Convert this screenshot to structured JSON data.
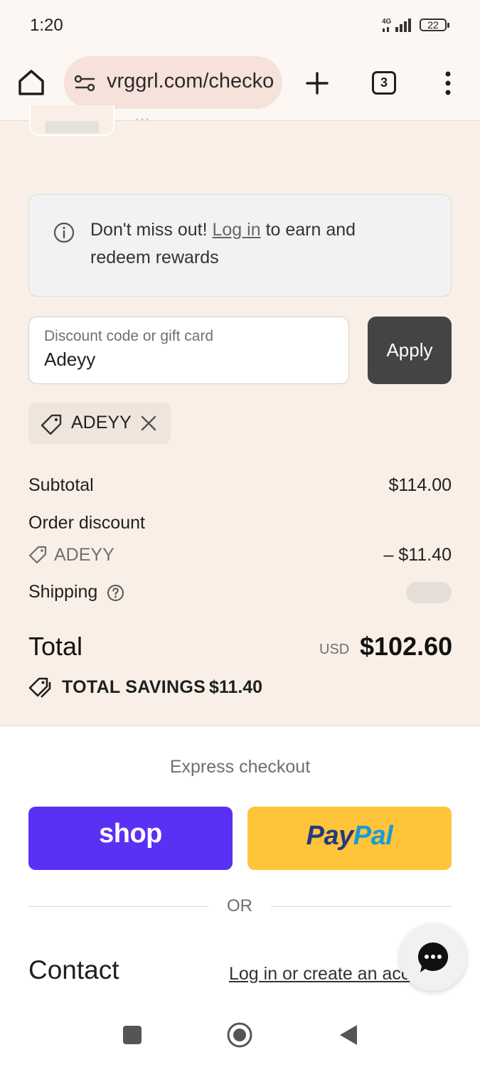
{
  "status_bar": {
    "time": "1:20",
    "network": "4G",
    "battery": "22"
  },
  "browser": {
    "url": "vrggrl.com/checkout",
    "tab_count": "3"
  },
  "rewards": {
    "prefix": "Don't miss out! ",
    "link": "Log in",
    "suffix": " to earn and redeem rewards"
  },
  "discount": {
    "placeholder": "Discount code or gift card",
    "value": "Adeyy",
    "apply_label": "Apply",
    "applied_code": "ADEYY"
  },
  "summary": {
    "subtotal_label": "Subtotal",
    "subtotal_value": "$114.00",
    "order_discount_label": "Order discount",
    "discount_code": "ADEYY",
    "discount_amount": "– $11.40",
    "shipping_label": "Shipping",
    "total_label": "Total",
    "currency": "USD",
    "total_value": "$102.60",
    "savings_label": "TOTAL SAVINGS",
    "savings_value": "$11.40"
  },
  "express": {
    "title": "Express checkout",
    "shop_label": "shop",
    "paypal_pay": "Pay",
    "paypal_pal": "Pal",
    "or_label": "OR"
  },
  "contact": {
    "title": "Contact",
    "login_link": "Log in or create an acc"
  },
  "colors": {
    "summary_bg": "#f9efe6",
    "shop_purple": "#5a31f4",
    "paypal_yellow": "#ffc439",
    "apply_dark": "#444444"
  }
}
